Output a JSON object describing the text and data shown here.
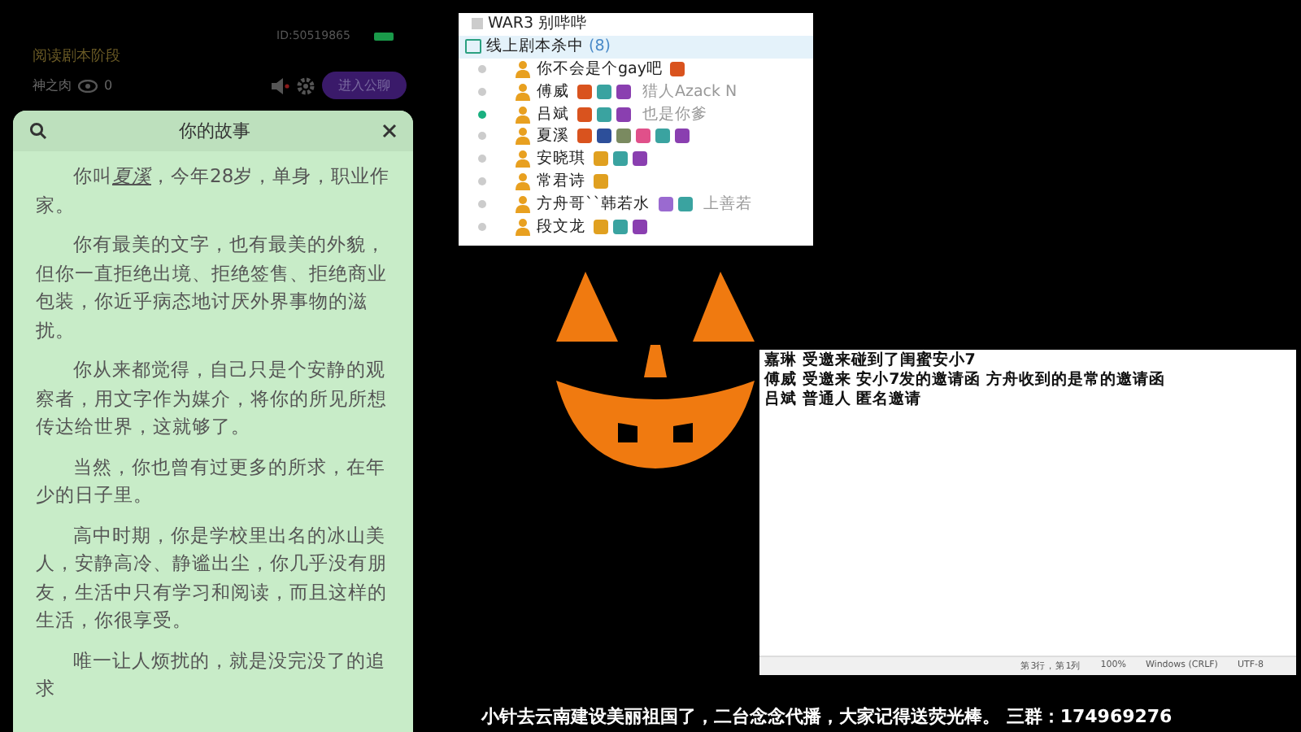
{
  "phone": {
    "id": "ID:50519865",
    "stage": "阅读剧本阶段",
    "user": "神之肉",
    "viewers": "0",
    "enter_button": "进入公聊",
    "muted": true
  },
  "story": {
    "title": "你的故事",
    "paragraphs": [
      {
        "before": "你叫",
        "name": "夏溪",
        "after": "，今年28岁，单身，职业作家。"
      },
      "你有最美的文字，也有最美的外貌，但你一直拒绝出境、拒绝签售、拒绝商业包装，你近乎病态地讨厌外界事物的滋扰。",
      "你从来都觉得，自己只是个安静的观察者，用文字作为媒介，将你的所见所想传达给世界，这就够了。",
      "当然，你也曾有过更多的所求，在年少的日子里。",
      "高中时期，你是学校里出名的冰山美人，安静高冷、静谧出尘，你几乎没有朋友，生活中只有学习和阅读，而且这样的生活，你很享受。",
      "唯一让人烦扰的，就是没完没了的追求"
    ]
  },
  "group_list": {
    "prev_group": "WAR3 别哔哔",
    "group": {
      "name": "线上剧本杀中",
      "count": "(8)",
      "expanded": true
    },
    "members": [
      {
        "name": "你不会是个gay吧",
        "online": false,
        "badges": [
          {
            "kind": "crown"
          }
        ]
      },
      {
        "name": "傅威",
        "online": false,
        "badges": [
          {
            "kind": "crown"
          },
          {
            "kind": "level"
          },
          {
            "kind": "star"
          }
        ],
        "status": "猎人Azack N"
      },
      {
        "name": "吕斌",
        "online": true,
        "badges": [
          {
            "kind": "crown"
          },
          {
            "kind": "level"
          },
          {
            "kind": "star"
          }
        ],
        "status": "也是你爹"
      },
      {
        "name": "夏溪",
        "online": false,
        "badges": [
          {
            "kind": "crown"
          },
          {
            "kind": "game"
          },
          {
            "kind": "photo"
          },
          {
            "kind": "pink"
          },
          {
            "kind": "level"
          },
          {
            "kind": "star"
          }
        ]
      },
      {
        "name": "安晓琪",
        "online": false,
        "badges": [
          {
            "kind": "vip"
          },
          {
            "kind": "level"
          },
          {
            "kind": "star"
          }
        ]
      },
      {
        "name": "常君诗",
        "online": false,
        "badges": [
          {
            "kind": "vip"
          }
        ]
      },
      {
        "name": "方舟哥``韩若水",
        "online": false,
        "badges": [
          {
            "kind": "round"
          },
          {
            "kind": "level"
          }
        ],
        "status": "上善若"
      },
      {
        "name": "段文龙",
        "online": false,
        "badges": [
          {
            "kind": "vip"
          },
          {
            "kind": "level"
          },
          {
            "kind": "star"
          }
        ]
      }
    ]
  },
  "notepad": {
    "lines": [
      "嘉琳 受邀来碰到了闺蜜安小7",
      "傅威 受邀来 安小7发的邀请函 方舟收到的是常的邀请函",
      "吕斌 普通人 匿名邀请"
    ],
    "status": [
      "第3行，第1列",
      "100%",
      "Windows (CRLF)",
      "UTF-8"
    ]
  },
  "caption": "小针去云南建设美丽祖国了，二台念念代播，大家记得送荧光棒。 三群：174969276"
}
